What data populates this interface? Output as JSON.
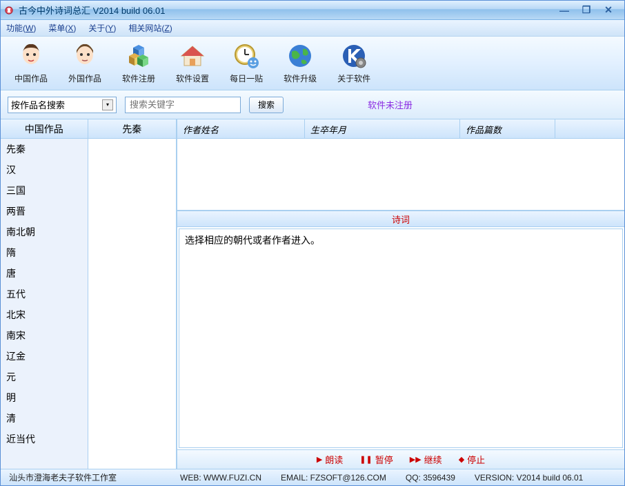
{
  "window": {
    "title": "古今中外诗词总汇 V2014 build 06.01"
  },
  "menus": [
    {
      "label": "功能",
      "key": "W"
    },
    {
      "label": "菜单",
      "key": "X"
    },
    {
      "label": "关于",
      "key": "Y"
    },
    {
      "label": "相关网站",
      "key": "Z"
    }
  ],
  "toolbar": [
    {
      "name": "chinese-works",
      "label": "中国作品",
      "icon": "face-female"
    },
    {
      "name": "foreign-works",
      "label": "外国作品",
      "icon": "face-male"
    },
    {
      "name": "register",
      "label": "软件注册",
      "icon": "cubes"
    },
    {
      "name": "settings",
      "label": "软件设置",
      "icon": "house"
    },
    {
      "name": "daily-tip",
      "label": "每日一贴",
      "icon": "clock-smile"
    },
    {
      "name": "upgrade",
      "label": "软件升级",
      "icon": "globe"
    },
    {
      "name": "about",
      "label": "关于软件",
      "icon": "k-gear"
    }
  ],
  "search": {
    "dropdown_value": "按作品名搜索",
    "input_placeholder": "搜索关键字",
    "button": "搜索",
    "unregistered": "软件未注册"
  },
  "left": {
    "col1_header": "中国作品",
    "col2_header": "先秦",
    "dynasties": [
      "先秦",
      "汉",
      "三国",
      "两晋",
      "南北朝",
      "隋",
      "唐",
      "五代",
      "北宋",
      "南宋",
      "辽金",
      "元",
      "明",
      "清",
      "近当代"
    ]
  },
  "columns": [
    "作者姓名",
    "生卒年月",
    "作品篇数",
    ""
  ],
  "poem": {
    "header": "诗词",
    "body_text": "选择相应的朝代或者作者进入。"
  },
  "playbar": {
    "read": "朗读",
    "pause": "暂停",
    "resume": "继续",
    "stop": "停止"
  },
  "status": {
    "studio": "汕头市澄海老夫子软件工作室",
    "web": "WEB: WWW.FUZI.CN",
    "email": "EMAIL: FZSOFT@126.COM",
    "qq": "QQ: 3596439",
    "version": "VERSION: V2014 build 06.01"
  }
}
